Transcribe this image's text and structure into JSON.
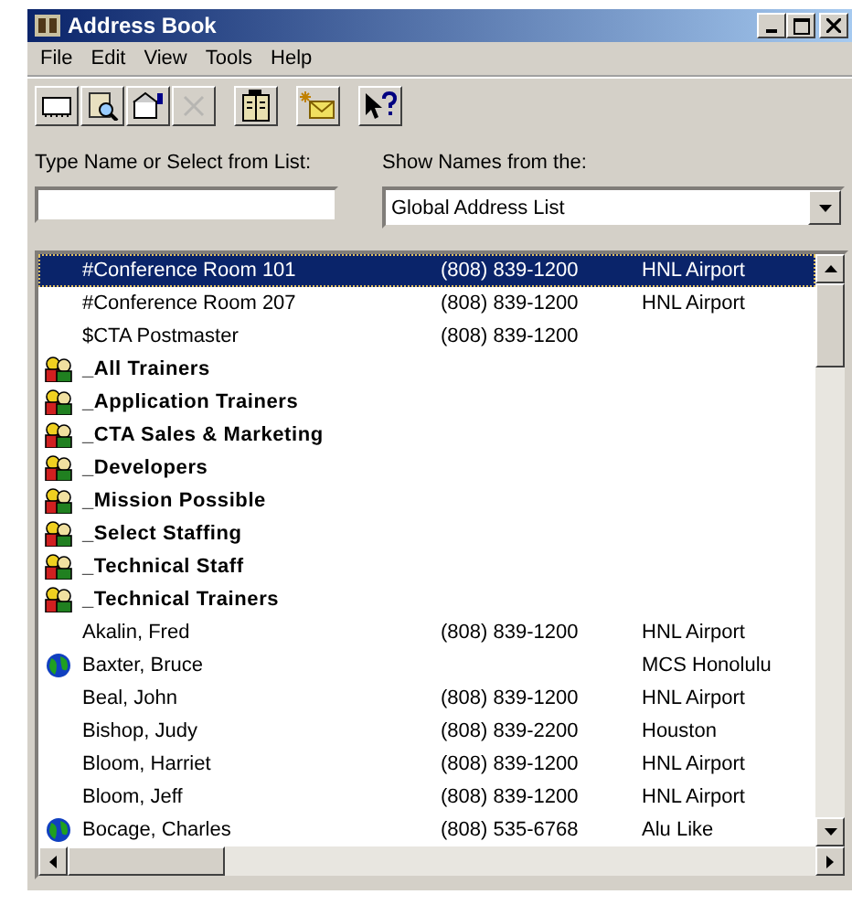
{
  "window": {
    "title": "Address Book"
  },
  "menu": [
    "File",
    "Edit",
    "View",
    "Tools",
    "Help"
  ],
  "toolbar": [
    {
      "kind": "new",
      "disabled": false
    },
    {
      "kind": "find",
      "disabled": false
    },
    {
      "kind": "properties",
      "disabled": false
    },
    {
      "kind": "delete",
      "disabled": true
    },
    {
      "kind": "book",
      "disabled": false
    },
    {
      "kind": "message",
      "disabled": false
    },
    {
      "kind": "help",
      "disabled": false
    }
  ],
  "name_field": {
    "label": "Type Name or Select from List:"
  },
  "source": {
    "label": "Show Names from the:",
    "value": "Global Address List"
  },
  "rows": [
    {
      "kind": "contact",
      "name": "#Conference Room 101",
      "phone": "(808) 839-1200",
      "location": "HNL Airport",
      "selected": true
    },
    {
      "kind": "contact",
      "name": "#Conference Room 207",
      "phone": "(808) 839-1200",
      "location": "HNL Airport",
      "selected": false
    },
    {
      "kind": "contact",
      "name": "$CTA Postmaster",
      "phone": "(808) 839-1200",
      "selected": false
    },
    {
      "kind": "group",
      "name": "_All Trainers",
      "selected": false
    },
    {
      "kind": "group",
      "name": "_Application Trainers",
      "selected": false
    },
    {
      "kind": "group",
      "name": "_CTA Sales & Marketing",
      "selected": false
    },
    {
      "kind": "group",
      "name": "_Developers",
      "selected": false
    },
    {
      "kind": "group",
      "name": "_Mission Possible",
      "selected": false
    },
    {
      "kind": "group",
      "name": "_Select Staffing",
      "selected": false
    },
    {
      "kind": "group",
      "name": "_Technical Staff",
      "selected": false
    },
    {
      "kind": "group",
      "name": "_Technical Trainers",
      "selected": false
    },
    {
      "kind": "contact",
      "name": "Akalin, Fred",
      "phone": "(808) 839-1200",
      "location": "HNL Airport",
      "selected": false
    },
    {
      "kind": "external",
      "name": "Baxter, Bruce",
      "location": "MCS Honolulu",
      "selected": false
    },
    {
      "kind": "contact",
      "name": "Beal, John",
      "phone": "(808) 839-1200",
      "location": "HNL Airport",
      "selected": false
    },
    {
      "kind": "contact",
      "name": "Bishop, Judy",
      "phone": "(808) 839-2200",
      "location": "Houston",
      "selected": false
    },
    {
      "kind": "contact",
      "name": "Bloom, Harriet",
      "phone": "(808) 839-1200",
      "location": "HNL Airport",
      "selected": false
    },
    {
      "kind": "contact",
      "name": "Bloom, Jeff",
      "phone": "(808) 839-1200",
      "location": "HNL Airport",
      "selected": false
    },
    {
      "kind": "external",
      "name": "Bocage, Charles",
      "phone": "(808) 535-6768",
      "location": "Alu Like",
      "selected": false
    }
  ]
}
